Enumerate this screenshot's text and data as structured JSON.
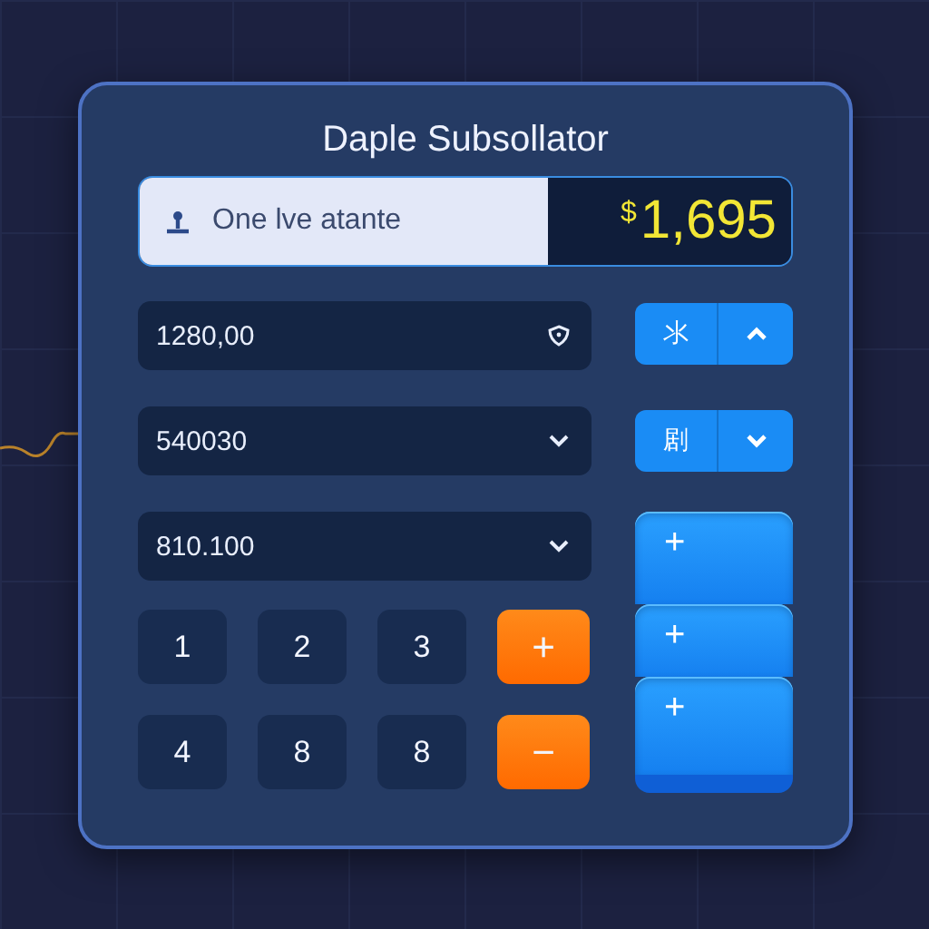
{
  "title": "Daple Subsollator",
  "display": {
    "label": "One lve atante",
    "currency": "$",
    "amount": "1,695"
  },
  "fields": [
    {
      "value": "1280,00",
      "kind": "shield"
    },
    {
      "value": "540030",
      "kind": "dropdown"
    },
    {
      "value": "810.100",
      "kind": "dropdown"
    }
  ],
  "side_buttons": [
    {
      "label": "氺",
      "kind": "up"
    },
    {
      "label": "剧",
      "kind": "down"
    }
  ],
  "stack_buttons": [
    {
      "label": "+"
    },
    {
      "label": "+"
    },
    {
      "label": "+"
    }
  ],
  "keys": [
    {
      "label": "1",
      "kind": "digit"
    },
    {
      "label": "2",
      "kind": "digit"
    },
    {
      "label": "3",
      "kind": "digit"
    },
    {
      "label": "+",
      "kind": "operator"
    },
    {
      "label": "4",
      "kind": "digit"
    },
    {
      "label": "8",
      "kind": "digit"
    },
    {
      "label": "8",
      "kind": "digit"
    },
    {
      "label": "−",
      "kind": "operator"
    }
  ]
}
